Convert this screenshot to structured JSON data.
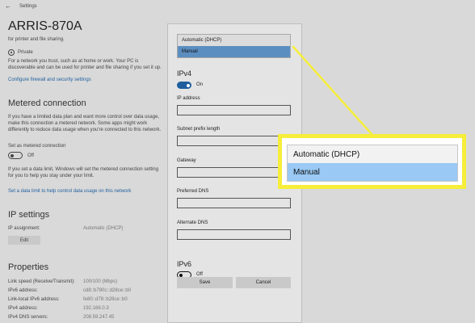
{
  "window": {
    "title": "Settings"
  },
  "page": {
    "heading": "ARRIS-870A"
  },
  "network_profile": {
    "intro": "for printer and file sharing.",
    "private_label": "Private",
    "private_desc_1": "For a network you trust, such as at home or work. Your PC is",
    "private_desc_2": "discoverable and can be used for printer and file sharing if you set it up.",
    "firewall_link": "Configure firewall and security settings"
  },
  "metered": {
    "heading": "Metered connection",
    "desc_1": "If you have a limited data plan and want more control over data usage,",
    "desc_2": "make this connection a metered network. Some apps might work",
    "desc_3": "differently to reduce data usage when you're connected to this network.",
    "toggle_label": "Set as metered connection",
    "toggle_state": "Off",
    "limit_desc_1": "If you set a data limit, Windows will set the metered connection setting",
    "limit_desc_2": "for you to help you stay under your limit.",
    "limit_link": "Set a data limit to help control data usage on this network"
  },
  "ip_settings": {
    "heading": "IP settings",
    "assignment_label": "IP assignment:",
    "assignment_value": "Automatic (DHCP)",
    "edit_label": "Edit"
  },
  "properties": {
    "heading": "Properties",
    "rows": [
      {
        "key": "Link speed (Receive/Transmit):",
        "value": "100/100 (Mbps)"
      },
      {
        "key": "IPv6 address:",
        "value": "cd8::b790c::d28ce::b0"
      },
      {
        "key": "Link-local IPv6 address:",
        "value": "fe80::d78::b28ce::b0"
      },
      {
        "key": "IPv4 address:",
        "value": "192.168.0.3"
      },
      {
        "key": "IPv4 DNS servers:",
        "value": "208.59.247.45"
      }
    ]
  },
  "dialog": {
    "dropdown_options": [
      "Automatic (DHCP)",
      "Manual"
    ],
    "selected_option": "Manual",
    "ipv4_heading": "IPv4",
    "ipv4_toggle_state": "On",
    "fields": [
      {
        "label": "IP address",
        "value": ""
      },
      {
        "label": "Subnet prefix length",
        "value": ""
      },
      {
        "label": "Gateway",
        "value": ""
      },
      {
        "label": "Preferred DNS",
        "value": ""
      },
      {
        "label": "Alternate DNS",
        "value": ""
      }
    ],
    "ipv6_heading": "IPv6",
    "ipv6_toggle_state": "Off",
    "save_label": "Save",
    "cancel_label": "Cancel"
  },
  "callout": {
    "options": [
      "Automatic (DHCP)",
      "Manual"
    ],
    "selected_option": "Manual"
  },
  "colors": {
    "highlight": "#f6ee3a",
    "selected_item": "#99c9f4",
    "toggle_on": "#1f5f9e"
  },
  "icons": {
    "back": "back-arrow-icon"
  }
}
